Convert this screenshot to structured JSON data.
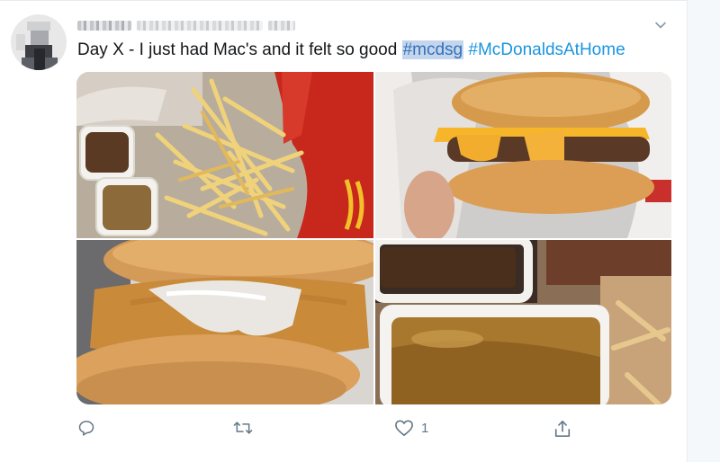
{
  "tweet": {
    "author_name_redacted": true,
    "text_prefix": "Day X - I just had Mac's and it felt so good",
    "hashtags": [
      "#mcdsg",
      "#McDonaldsAtHome"
    ],
    "selected_hashtag_index": 0
  },
  "media": [
    {
      "alt": "fries-and-dipping-sauces"
    },
    {
      "alt": "cheeseburger-in-wrapper"
    },
    {
      "alt": "fish-sandwich"
    },
    {
      "alt": "sauce-cups-closeup"
    }
  ],
  "actions": {
    "reply_count": "",
    "retweet_count": "",
    "like_count": "1",
    "share_label": ""
  },
  "colors": {
    "hashtag": "#1b95e0",
    "hashtag_selected_bg": "#c4d6ee",
    "icon_gray": "#657786"
  },
  "icons": [
    "reply-icon",
    "retweet-icon",
    "like-icon",
    "share-icon",
    "chevron-down-icon"
  ]
}
